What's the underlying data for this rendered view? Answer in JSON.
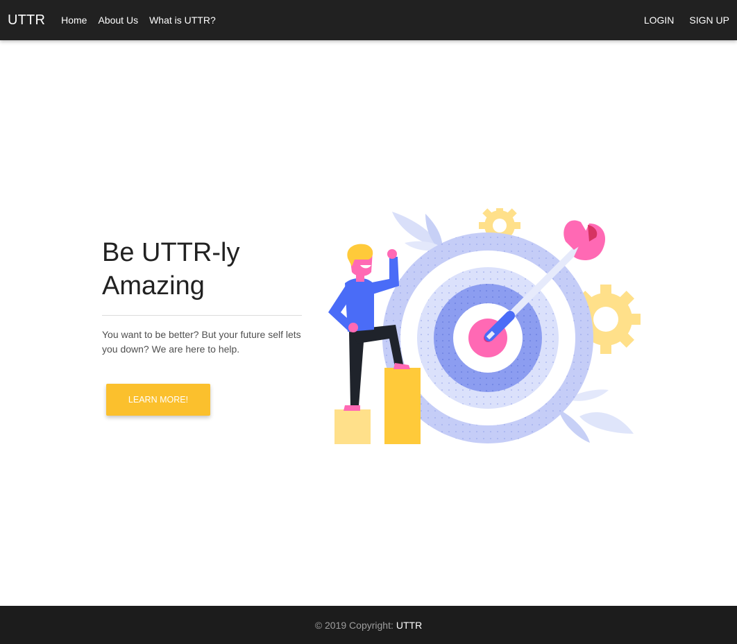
{
  "navbar": {
    "brand": "UTTR",
    "links": [
      "Home",
      "About Us",
      "What is UTTR?"
    ],
    "auth": {
      "login": "LOGIN",
      "signup": "SIGN UP"
    }
  },
  "hero": {
    "title_line1": "Be UTTR-ly",
    "title_line2": "Amazing",
    "description": "You want to be better? But your future self lets you down? We are here to help.",
    "cta": "LEARN MORE!"
  },
  "footer": {
    "copyright": "© 2019 Copyright:",
    "brand": "UTTR"
  },
  "colors": {
    "navbar_bg": "#212121",
    "accent": "#fbc02d",
    "target_light": "#c5cdf7",
    "target_mid": "#8c9df0",
    "bullseye": "#ff69b4",
    "person_shirt": "#4a6cf7"
  },
  "illustration": {
    "icon_names": [
      "target-icon",
      "arrow-icon",
      "gear-icon",
      "leaf-icon",
      "person-icon",
      "steps-icon"
    ]
  }
}
